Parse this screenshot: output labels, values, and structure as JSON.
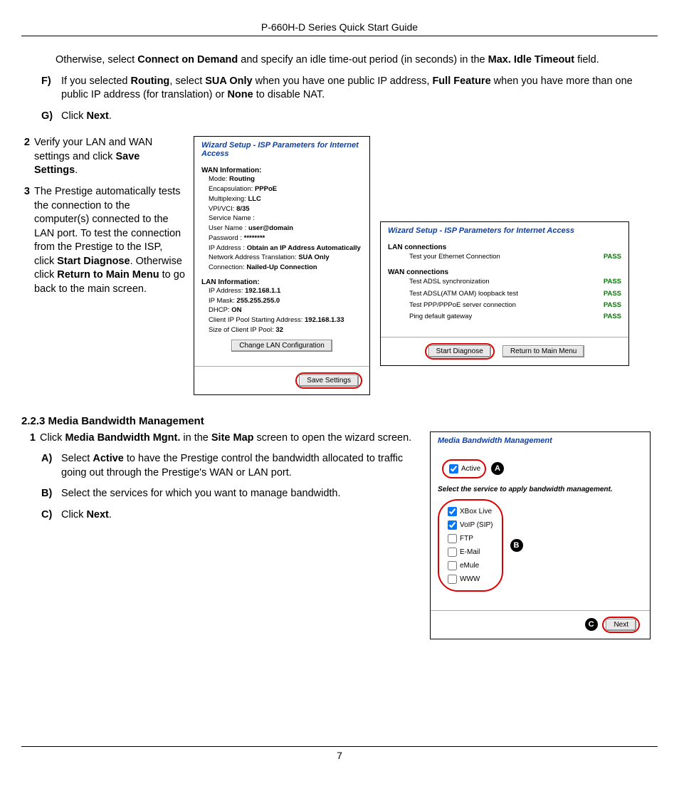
{
  "running_header": "P-660H-D Series Quick Start Guide",
  "page_number": "7",
  "s1": {
    "otherwise": "Otherwise, select ",
    "cod": "Connect on Demand",
    "otherwise2": " and specify an idle time-out period (in seconds) in the ",
    "max_idle": "Max. Idle Timeout",
    "otherwise3": " field.",
    "f_label": "F)",
    "f_text1": "If you selected ",
    "f_routing": "Routing",
    "f_text2": ", select ",
    "f_sua": "SUA Only",
    "f_text3": " when you have one public IP address, ",
    "f_full": "Full Feature",
    "f_text4": " when you have more than one public IP address (for translation) or ",
    "f_none": "None",
    "f_text5": " to disable NAT.",
    "g_label": "G)",
    "g_text1": "Click ",
    "g_next": "Next",
    "g_text2": "."
  },
  "s2": {
    "num2": "2",
    "verify_text1": "Verify your LAN and WAN settings and click ",
    "save_settings": "Save Settings",
    "verify_text2": ".",
    "num3": "3",
    "t3_1": "The Prestige automatically tests the connection to the computer(s) connected to the LAN port. To test the connection from the Prestige to the ISP, click ",
    "start_diag": "Start Diagnose",
    "t3_2": ". Otherwise click ",
    "ret_main": "Return to Main Menu",
    "t3_3": " to go back to the main screen."
  },
  "panel_a": {
    "title": "Wizard Setup - ISP Parameters for Internet Access",
    "wan_h": "WAN Information:",
    "mode": "Mode: ",
    "mode_v": "Routing",
    "encap": "Encapsulation: ",
    "encap_v": "PPPoE",
    "mux": "Multiplexing: ",
    "mux_v": "LLC",
    "vpi": "VPI/VCI: ",
    "vpi_v": "8/35",
    "svc": "Service Name :",
    "user": "User Name : ",
    "user_v": "user@domain",
    "pwd": "Password : ",
    "pwd_v": "********",
    "ip": "IP Address : ",
    "ip_v": "Obtain an IP Address Automatically",
    "nat": "Network Address Translation: ",
    "nat_v": "SUA Only",
    "conn": "Connection: ",
    "conn_v": "Nailed-Up Connection",
    "lan_h": "LAN Information:",
    "lan_ip": "IP Address: ",
    "lan_ip_v": "192.168.1.1",
    "lan_mask": "IP Mask: ",
    "lan_mask_v": "255.255.255.0",
    "dhcp": "DHCP: ",
    "dhcp_v": "ON",
    "pool": "Client IP Pool Starting Address: ",
    "pool_v": "192.168.1.33",
    "pool_size": "Size of Client IP Pool: ",
    "pool_size_v": "32",
    "change_lan": "Change LAN Configuration",
    "save_btn": "Save Settings"
  },
  "panel_b": {
    "title": "Wizard Setup - ISP Parameters for Internet Access",
    "lan_h": "LAN connections",
    "lan_test": "Test your Ethernet Connection",
    "wan_h": "WAN connections",
    "w1": "Test ADSL synchronization",
    "w2": "Test ADSL(ATM OAM) loopback test",
    "w3": "Test PPP/PPPoE server connection",
    "w4": "Ping default gateway",
    "pass": "PASS",
    "start_btn": "Start Diagnose",
    "return_btn": "Return to Main Menu"
  },
  "media": {
    "heading": "2.2.3 Media Bandwidth Management",
    "n1": "1",
    "n1_t1": "Click ",
    "n1_b1": "Media Bandwidth Mgnt.",
    "n1_t2": " in the ",
    "n1_b2": "Site Map",
    "n1_t3": " screen to open the wizard screen.",
    "a_label": "A)",
    "a_t1": "Select ",
    "a_b1": "Active",
    "a_t2": " to have the Prestige control the bandwidth allocated to traffic going out through the Prestige's WAN or LAN port.",
    "b_label": "B)",
    "b_t1": "Select the services for which you want to manage bandwidth.",
    "c_label": "C)",
    "c_t1": "Click ",
    "c_b1": "Next",
    "c_t2": "."
  },
  "panel_c": {
    "title": "Media Bandwidth Management",
    "active_label": "Active",
    "note": "Select the service to apply bandwidth management.",
    "svc_xbox": "XBox Live",
    "svc_voip": "VoIP (SIP)",
    "svc_ftp": "FTP",
    "svc_email": "E-Mail",
    "svc_emule": "eMule",
    "svc_www": "WWW",
    "next_btn": "Next",
    "call_a": "A",
    "call_b": "B",
    "call_c": "C"
  }
}
